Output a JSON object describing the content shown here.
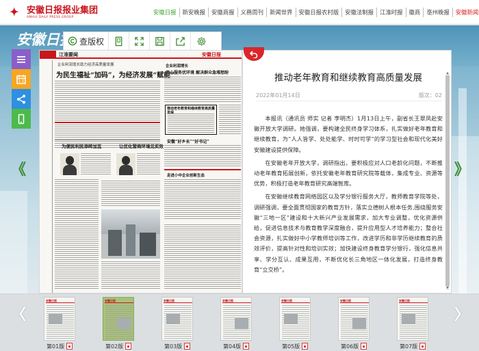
{
  "header": {
    "logo_cn": "安徽日报报业集团",
    "logo_en": "ANHUI DAILY PRESS GROUP",
    "nav": [
      {
        "label": "安徽日报",
        "style": "green"
      },
      {
        "label": "新安晚报",
        "style": ""
      },
      {
        "label": "安徽商报",
        "style": ""
      },
      {
        "label": "义務周刊",
        "style": ""
      },
      {
        "label": "新闻世界",
        "style": ""
      },
      {
        "label": "安徽日报农村版",
        "style": ""
      },
      {
        "label": "安徽法制报",
        "style": ""
      },
      {
        "label": "江淮时报",
        "style": ""
      },
      {
        "label": "徽商",
        "style": ""
      },
      {
        "label": "亳州晚报",
        "style": ""
      },
      {
        "label": "安徽新闻网",
        "style": "red"
      }
    ]
  },
  "banner": {
    "logo": "安徽日报"
  },
  "toolbar": {
    "mode_label": "查版权",
    "icons": [
      "page-view-icon",
      "fullscreen-icon",
      "save-icon",
      "share-out-icon",
      "settings-icon"
    ]
  },
  "side_buttons": [
    {
      "name": "menu-icon",
      "color": "#8a5fc9"
    },
    {
      "name": "calendar-icon",
      "color": "#f5a623"
    },
    {
      "name": "share-icon",
      "color": "#2f8fe0"
    },
    {
      "name": "mobile-icon",
      "color": "#4cba4c"
    }
  ],
  "paper": {
    "mast_left": "江淮要闻",
    "mast_right": "安徽日报",
    "headline_1": "为民生福祉“加码”，为经济发展“赋能”",
    "kicker_1": "企业利润增长助力经济高质量发展",
    "headline_2": "推动老年教育和继续教育高质量发展",
    "headline_3": "为便民利民添砖加瓦",
    "headline_4": "让优化营商环境见实效",
    "headline_5": "安徽“好乡长”“好书记”",
    "headline_6": "走进小中企业创新生态"
  },
  "article": {
    "title": "推动老年教育和继续教育高质量发展",
    "date": "2022年01月14日",
    "edition": "版次：02",
    "paragraphs": [
      "本报讯（通讯员 师实 记者 李明杰）1月13日上午，副省长王翠凤赴安徽开放大学调研。她强调，要构建全民终身学习体系，扎实做好老年教育和继续教育，为“人人皆学、处处能学、时时可学”的学习型社会和现代化美好安徽建设提供保障。",
      "在安徽老年开放大学，调研指出，要积极应对人口老龄化问题，不断推动老年教育拓展创新，依托安徽老年教育研究院等载体，集成专业、资源等优势，积极打造老年教育研究高端智库。",
      "在安徽继续教育网络园区以及学分银行服务大厅，教师教育学院等处，调研强调，要全面贯彻国家的教育方针，落实立德树人根本任务,围绕服务安徽“三地一区”建设和十大新兴产业发展需求，加大专业调整，优化资源供给，促进信息技术与教育教学深度融合，提升应用型人才培养能力；整合社会资源，扎实做好中小学教师培训等工作，改进学历和非学历继续教育的质效评价，提高针对性和培训实效；加快建设终身教育学分银行，强化信息共享、学分互认、成果互用，不断优化长三角地区一体化发展，打造终身教育“立交桥”。"
    ]
  },
  "thumbnails": [
    {
      "label": "第01版",
      "active": false
    },
    {
      "label": "第02版",
      "active": true
    },
    {
      "label": "第03版",
      "active": false
    },
    {
      "label": "第04版",
      "active": false
    },
    {
      "label": "第05版",
      "active": false
    },
    {
      "label": "第06版",
      "active": false
    },
    {
      "label": "第07版",
      "active": false
    }
  ],
  "arrows": {
    "left": "《",
    "right": "》",
    "strip_left": "〈",
    "strip_right": "〉"
  },
  "colors": {
    "brand_red": "#c8161d",
    "nav_green": "#3fa535",
    "arrow_green": "#3c8c2e"
  }
}
